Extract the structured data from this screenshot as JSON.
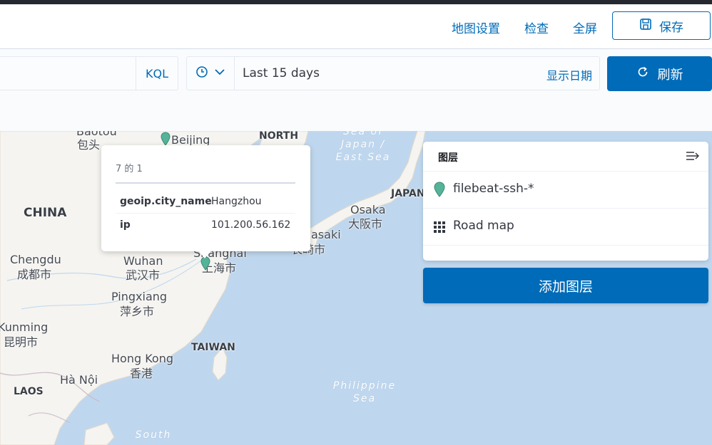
{
  "header": {
    "map_settings": "地图设置",
    "inspect": "检查",
    "fullscreen": "全屏",
    "save": "保存"
  },
  "query": {
    "language": "KQL"
  },
  "time": {
    "range": "Last 15 days",
    "show_dates": "显示日期",
    "refresh": "刷新"
  },
  "map_labels": {
    "baotou_en": "Baotou",
    "baotou_zh": "包头",
    "beijing": "Beijing",
    "north_korea": "NORTH",
    "china": "CHINA",
    "chengdu_en": "Chengdu",
    "chengdu_zh": "成都市",
    "wuhan_en": "Wuhan",
    "wuhan_zh": "武汉市",
    "shanghai_en": "Shanghai",
    "shanghai_zh": "上海市",
    "pingxiang_en": "Pingxiang",
    "pingxiang_zh": "萍乡市",
    "kunming_en": "Kunming",
    "kunming_zh": "昆明市",
    "hongkong_en": "Hong Kong",
    "hongkong_zh": "香港",
    "hanoi": "Hà Nội",
    "laos": "LAOS",
    "taiwan": "TAIWAN",
    "japan": "JAPAN",
    "osaka_en": "Osaka",
    "osaka_zh": "大阪市",
    "nagasaki_en": "asaki",
    "nagasaki_zh": "长崎市",
    "sea_of_japan_1": "Sea of",
    "sea_of_japan_2": "Japan /",
    "east_sea": "East Sea",
    "philippine_sea_1": "Philippine",
    "philippine_sea_2": "Sea",
    "south_china_sea": "South"
  },
  "tooltip": {
    "title": "7 的 1",
    "rows": [
      {
        "key": "geoip.city_name",
        "value": "Hangzhou"
      },
      {
        "key": "ip",
        "value": "101.200.56.162"
      }
    ]
  },
  "legend": {
    "title": "图层",
    "layers": [
      {
        "name": "filebeat-ssh-*",
        "icon": "map-marker-icon"
      },
      {
        "name": "Road map",
        "icon": "grid-icon"
      }
    ],
    "add_layer": "添加图层"
  },
  "colors": {
    "primary": "#006bb8",
    "marker": "#54b399",
    "water": "#bfd7ee",
    "land": "#f5f4f0"
  }
}
